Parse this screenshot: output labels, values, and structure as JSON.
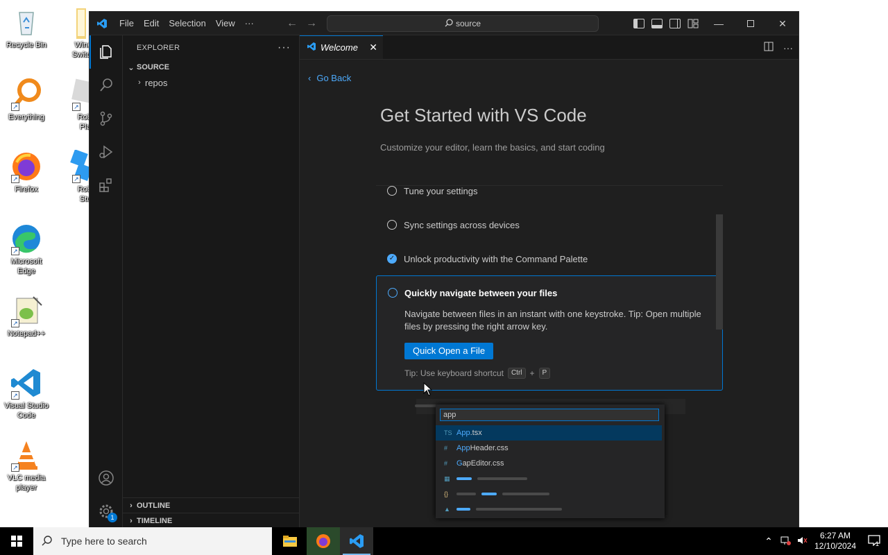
{
  "desktop": {
    "icons": [
      {
        "label": "Recycle Bin"
      },
      {
        "label": "Windws\nSwitch A"
      },
      {
        "label": "Everything"
      },
      {
        "label": "Roblox\nPlayer"
      },
      {
        "label": "Firefox"
      },
      {
        "label": "Roblox\nStudio"
      },
      {
        "label": "Microsoft\nEdge"
      },
      {
        "label": "Notepad++"
      },
      {
        "label": "Visual Studio\nCode"
      },
      {
        "label": "VLC media\nplayer"
      }
    ]
  },
  "vscode": {
    "menu": [
      "File",
      "Edit",
      "Selection",
      "View",
      "···"
    ],
    "command_center": "source",
    "explorer": {
      "title": "EXPLORER",
      "root": "SOURCE",
      "folders": [
        "repos"
      ],
      "outline": "OUTLINE",
      "timeline": "TIMELINE"
    },
    "accounts_badge": "1",
    "tab": {
      "label": "Welcome"
    },
    "welcome": {
      "go_back": "Go Back",
      "title": "Get Started with VS Code",
      "subtitle": "Customize your editor, learn the basics, and start coding",
      "steps": [
        {
          "label": "Tune your settings",
          "done": false
        },
        {
          "label": "Sync settings across devices",
          "done": false
        },
        {
          "label": "Unlock productivity with the Command Palette",
          "done": true
        }
      ],
      "active_step": {
        "title": "Quickly navigate between your files",
        "description": "Navigate between files in an instant with one keystroke. Tip: Open multiple files by pressing the right arrow key.",
        "button": "Quick Open a File",
        "tip": "Tip: Use keyboard shortcut",
        "keys": [
          "Ctrl",
          "+",
          "P"
        ]
      },
      "quick_open_preview": {
        "query": "app",
        "results": [
          {
            "icon": "TS",
            "match": "App",
            "rest": ".tsx"
          },
          {
            "icon": "#",
            "match": "App",
            "rest": "Header.css"
          },
          {
            "icon": "#",
            "match": "G",
            "rest": "apEditor.css"
          }
        ]
      }
    }
  },
  "taskbar": {
    "search_placeholder": "Type here to search",
    "time": "6:27 AM",
    "date": "12/10/2024",
    "notification_count": "1"
  }
}
